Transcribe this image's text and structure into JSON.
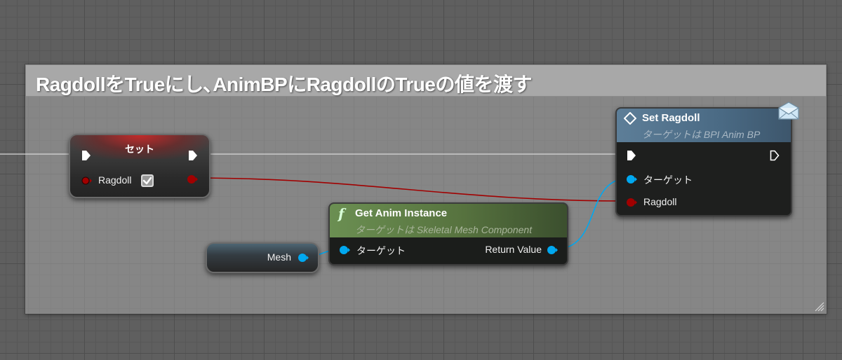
{
  "comment": {
    "title": "RagdollをTrueにし､AnimBPにRagdollのTrueの値を渡す"
  },
  "set_node": {
    "title": "セット",
    "pin_label": "Ragdoll",
    "checkbox_checked": true
  },
  "get_anim_instance_node": {
    "title": "Get Anim Instance",
    "subtitle": "ターゲットは Skeletal Mesh Component",
    "input_label": "ターゲット",
    "output_label": "Return Value",
    "function_glyph": "f"
  },
  "set_ragdoll_node": {
    "title": "Set Ragdoll",
    "subtitle": "ターゲットは BPI Anim BP",
    "target_label": "ターゲット",
    "ragdoll_label": "Ragdoll",
    "icon": "envelope-icon"
  },
  "mesh_node": {
    "label": "Mesh"
  },
  "colors": {
    "bool_pin": "#a10000",
    "object_pin": "#00a8f0",
    "exec_pin": "#ffffff",
    "function_header": "#6b8f52",
    "interface_header": "#5d7e98",
    "set_header": "#c82828"
  }
}
